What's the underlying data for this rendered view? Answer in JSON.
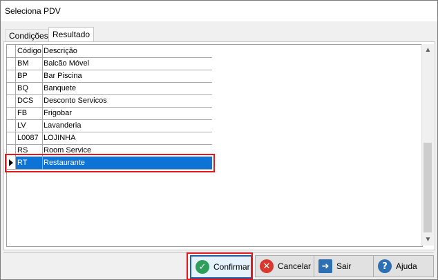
{
  "window": {
    "title": "Seleciona PDV"
  },
  "tabs": [
    {
      "label": "Condições",
      "active": false
    },
    {
      "label": "Resultado",
      "active": true
    }
  ],
  "grid": {
    "columns": [
      "Código",
      "Descrição"
    ],
    "rows": [
      {
        "codigo": "BM",
        "descricao": "Balcão Móvel"
      },
      {
        "codigo": "BP",
        "descricao": "Bar Piscina"
      },
      {
        "codigo": "BQ",
        "descricao": "Banquete"
      },
      {
        "codigo": "DCS",
        "descricao": "Desconto Servicos"
      },
      {
        "codigo": "FB",
        "descricao": "Frigobar"
      },
      {
        "codigo": "LV",
        "descricao": "Lavanderia"
      },
      {
        "codigo": "L0087",
        "descricao": "LOJINHA"
      },
      {
        "codigo": "RS",
        "descricao": "Room Service"
      },
      {
        "codigo": "RT",
        "descricao": "Restaurante"
      }
    ],
    "selected_index": 8
  },
  "buttons": {
    "confirm": "Confirmar",
    "cancel": "Cancelar",
    "exit": "Sair",
    "help": "Ajuda"
  },
  "colors": {
    "selection": "#0e73d6",
    "highlight": "#e0191f",
    "confirm_icon": "#2e9e5b",
    "cancel_icon": "#d9382f",
    "exit_icon": "#2c6fb4",
    "help_icon": "#2c6fb4"
  }
}
